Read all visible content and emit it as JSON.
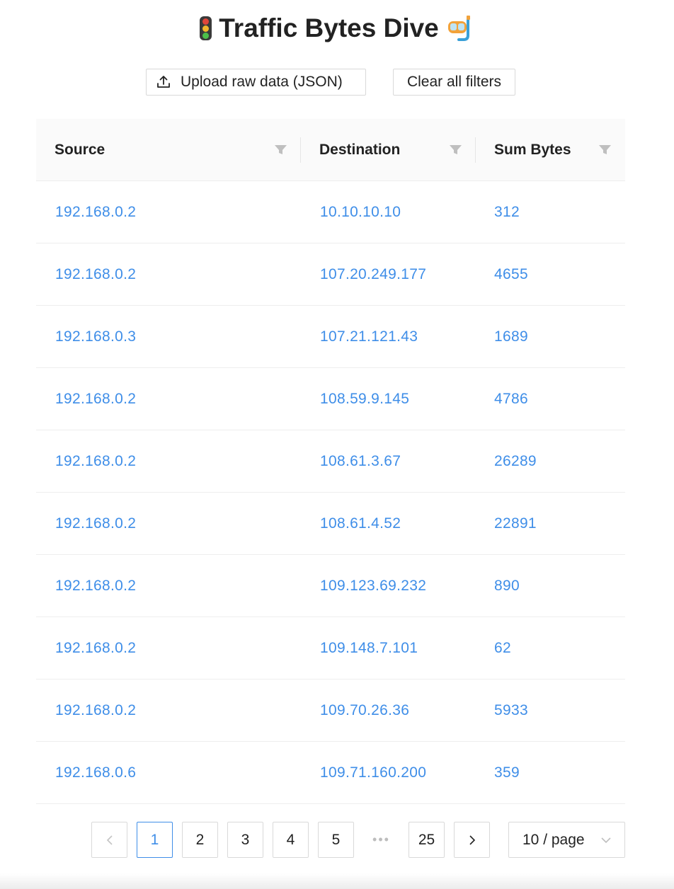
{
  "header": {
    "title": "Traffic Bytes Dive",
    "left_icon": "traffic-light-icon",
    "right_icon": "diving-mask-icon"
  },
  "toolbar": {
    "upload_label": "Upload raw data (JSON)",
    "upload_icon": "upload-icon",
    "clear_label": "Clear all filters"
  },
  "table": {
    "columns": [
      "Source",
      "Destination",
      "Sum Bytes"
    ],
    "rows": [
      {
        "source": "192.168.0.2",
        "destination": "10.10.10.10",
        "sum_bytes": "312"
      },
      {
        "source": "192.168.0.2",
        "destination": "107.20.249.177",
        "sum_bytes": "4655"
      },
      {
        "source": "192.168.0.3",
        "destination": "107.21.121.43",
        "sum_bytes": "1689"
      },
      {
        "source": "192.168.0.2",
        "destination": "108.59.9.145",
        "sum_bytes": "4786"
      },
      {
        "source": "192.168.0.2",
        "destination": "108.61.3.67",
        "sum_bytes": "26289"
      },
      {
        "source": "192.168.0.2",
        "destination": "108.61.4.52",
        "sum_bytes": "22891"
      },
      {
        "source": "192.168.0.2",
        "destination": "109.123.69.232",
        "sum_bytes": "890"
      },
      {
        "source": "192.168.0.2",
        "destination": "109.148.7.101",
        "sum_bytes": "62"
      },
      {
        "source": "192.168.0.2",
        "destination": "109.70.26.36",
        "sum_bytes": "5933"
      },
      {
        "source": "192.168.0.6",
        "destination": "109.71.160.200",
        "sum_bytes": "359"
      }
    ]
  },
  "pagination": {
    "pages": [
      "1",
      "2",
      "3",
      "4",
      "5"
    ],
    "ellipsis": "•••",
    "last_page": "25",
    "current_page": "1",
    "page_size_label": "10 / page"
  },
  "colors": {
    "link": "#3f8ee8",
    "active_border": "#3f8ee8",
    "header_bg": "#fafafa"
  }
}
